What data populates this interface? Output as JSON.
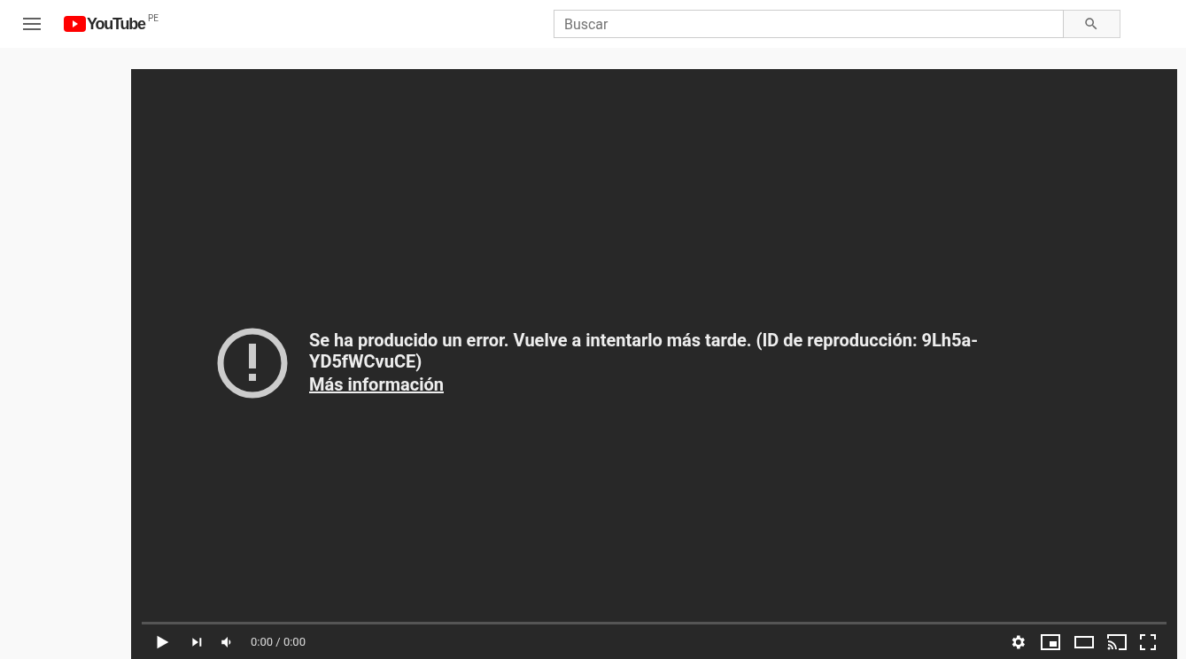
{
  "header": {
    "logo": "YouTube",
    "region": "PE",
    "search": {
      "placeholder": "Buscar"
    }
  },
  "player": {
    "error": {
      "message": "Se ha producido un error. Vuelve a intentarlo más tarde. (ID de reproducción: 9Lh5a-YD5fWCvuCE)",
      "link": "Más información"
    },
    "progress": {
      "level": 0
    },
    "time": "0:00 / 0:00"
  }
}
